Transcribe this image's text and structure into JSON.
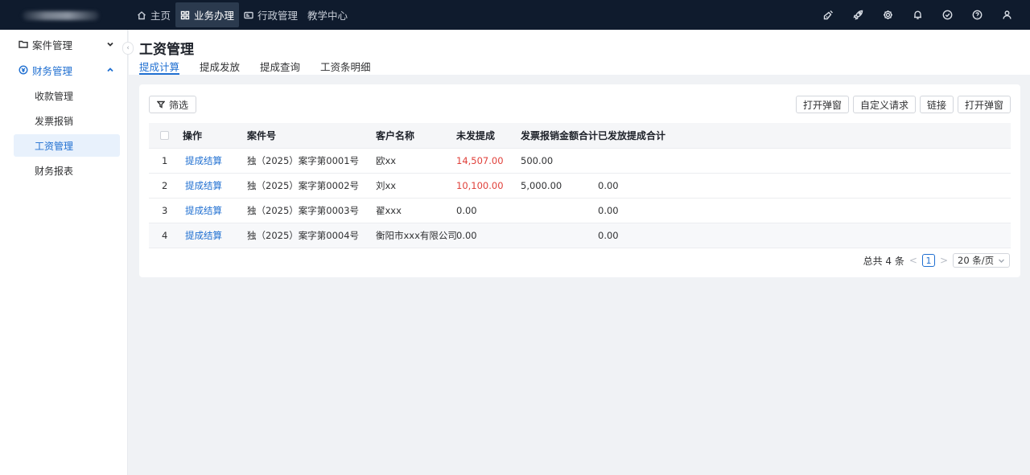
{
  "topnav": {
    "items": [
      {
        "label": "主页",
        "icon": "home-icon"
      },
      {
        "label": "业务办理",
        "icon": "grid-icon"
      },
      {
        "label": "行政管理",
        "icon": "id-card-icon"
      },
      {
        "label": "教学中心",
        "icon": ""
      }
    ],
    "right_icons": [
      "broom-icon",
      "rocket-icon",
      "gear-icon",
      "bell-icon",
      "check-circle-icon",
      "help-icon",
      "user-icon"
    ]
  },
  "sidebar": {
    "groups": [
      {
        "label": "案件管理",
        "icon": "folder-icon"
      },
      {
        "label": "财务管理",
        "icon": "finance-icon"
      }
    ],
    "items": [
      {
        "label": "收款管理"
      },
      {
        "label": "发票报销"
      },
      {
        "label": "工资管理"
      },
      {
        "label": "财务报表"
      }
    ]
  },
  "page": {
    "title": "工资管理",
    "tabs": [
      "提成计算",
      "提成发放",
      "提成查询",
      "工资条明细"
    ]
  },
  "toolbar": {
    "filter_label": "筛选",
    "buttons": [
      "打开弹窗",
      "自定义请求",
      "链接",
      "打开弹窗"
    ]
  },
  "table": {
    "columns": [
      "操作",
      "案件号",
      "客户名称",
      "未发提成",
      "发票报销金额合计",
      "已发放提成合计"
    ],
    "rows": [
      {
        "index": "1",
        "action": "提成结算",
        "case_no": "独（2025）案字第0001号",
        "client": "欧xx",
        "unpaid": "14,507.00",
        "invoice_total": "500.00",
        "paid_total": ""
      },
      {
        "index": "2",
        "action": "提成结算",
        "case_no": "独（2025）案字第0002号",
        "client": "刘xx",
        "unpaid": "10,100.00",
        "invoice_total": "5,000.00",
        "paid_total": "0.00"
      },
      {
        "index": "3",
        "action": "提成结算",
        "case_no": "独（2025）案字第0003号",
        "client": "翟xxx",
        "unpaid": "0.00",
        "invoice_total": "",
        "paid_total": "0.00"
      },
      {
        "index": "4",
        "action": "提成结算",
        "case_no": "独（2025）案字第0004号",
        "client": "衡阳市xxx有限公司",
        "unpaid": "0.00",
        "invoice_total": "",
        "paid_total": "0.00"
      }
    ]
  },
  "pagination": {
    "total": "总共 4 条",
    "current": "1",
    "page_size": "20 条/页"
  },
  "colors": {
    "accent": "#1f6fd1",
    "topbar": "#0f1b2d",
    "negative": "#e0403a"
  }
}
